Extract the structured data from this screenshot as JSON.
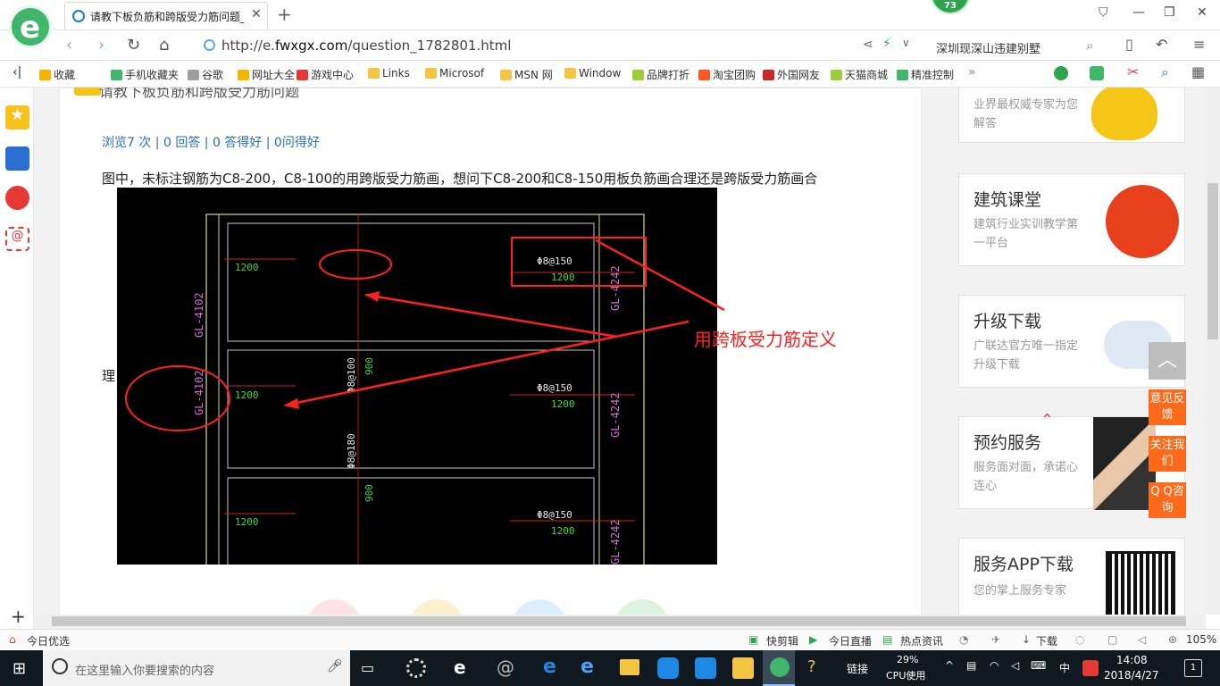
{
  "browser": {
    "tab_title": "请教下板负筋和跨版受力筋问题_",
    "badge_count": "73",
    "url_prefix": "http://e.",
    "url_domain": "fwxgx.com",
    "url_path": "/question_1782801.html",
    "search_text": "深圳现深山违建别墅"
  },
  "bookmarks": [
    {
      "label": "收藏",
      "color": "#f4b400"
    },
    {
      "label": "手机收藏夹",
      "color": "#3fb66a"
    },
    {
      "label": "谷歌",
      "color": "#9e9e9e"
    },
    {
      "label": "网址大全",
      "color": "#f4b400"
    },
    {
      "label": "游戏中心",
      "color": "#e53935"
    },
    {
      "label": "Links",
      "color": "#f4c542"
    },
    {
      "label": "Microsof",
      "color": "#f4c542"
    },
    {
      "label": "MSN 网",
      "color": "#f4c542"
    },
    {
      "label": "Window",
      "color": "#f4c542"
    },
    {
      "label": "品牌打折",
      "color": "#9ccc3b"
    },
    {
      "label": "淘宝团购",
      "color": "#ff5722"
    },
    {
      "label": "外国网友",
      "color": "#c62828"
    },
    {
      "label": "天猫商城",
      "color": "#9ccc3b"
    },
    {
      "label": "精准控制",
      "color": "#3fb66a"
    }
  ],
  "question": {
    "title": "请教下板负筋和跨版受力筋问题",
    "stats": "浏览7 次 | 0 回答 | 0 答得好 | 0问得好",
    "text": "图中，未标注钢筋为C8-200，C8-100的用跨版受力筋画，想问下C8-200和C8-150用板负筋画合理还是跨版受力筋画合",
    "text_tail": "理"
  },
  "drawing": {
    "annotation": "用跨板受力筋定义",
    "labels": {
      "dim": "1200",
      "rebar150": "Φ8@150",
      "rebar100": "Φ8@100",
      "rebar180": "Φ8@180",
      "gl_left": "GL-4102",
      "gl_right": "GL-4242",
      "val900": "900"
    }
  },
  "sidebar": [
    {
      "title": "",
      "desc": "业界最权威专家为您解答",
      "icon_color": "#f5c518"
    },
    {
      "title": "建筑课堂",
      "desc": "建筑行业实训教学第一平台",
      "icon_color": "#e8401c"
    },
    {
      "title": "升级下载",
      "desc": "广联达官方唯一指定升级下载",
      "icon_color": "#1e88e5"
    },
    {
      "title": "预约服务",
      "desc": "服务面对面，承诺心连心",
      "icon_color": "#333333"
    },
    {
      "title": "服务APP下载",
      "desc": "您的掌上服务专家",
      "icon_color": "#111111"
    }
  ],
  "float_buttons": [
    "意见反馈",
    "关注我们",
    "Q Q咨询"
  ],
  "statusbar": {
    "left": "今日优选",
    "items": [
      "快剪辑",
      "今日直播",
      "热点资讯"
    ],
    "download": "下载",
    "zoom": "105%"
  },
  "taskbar": {
    "search_placeholder": "在这里输入你要搜索的内容",
    "link_label": "链接",
    "cpu_percent": "29%",
    "cpu_label": "CPU使用",
    "ime": "中",
    "time": "14:08",
    "date": "2018/4/27",
    "notifications": "1"
  }
}
